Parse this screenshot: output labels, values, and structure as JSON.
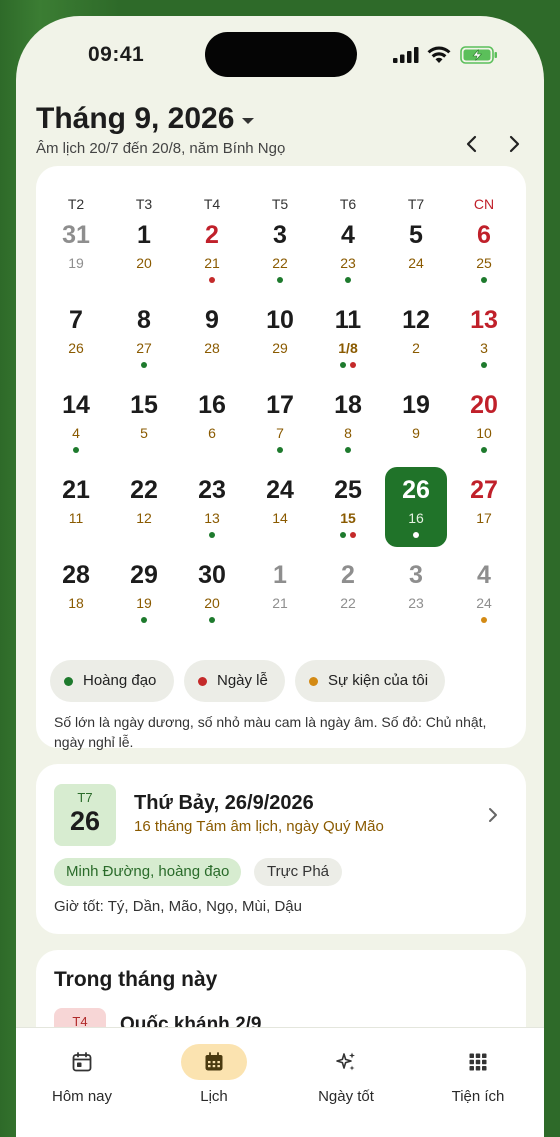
{
  "status_bar": {
    "time": "09:41"
  },
  "header": {
    "month_title": "Tháng 9, 2026",
    "subtitle": "Âm lịch 20/7 đến 20/8, năm Bính Ngọ"
  },
  "calendar": {
    "weekdays": [
      "T2",
      "T3",
      "T4",
      "T5",
      "T6",
      "T7",
      "CN"
    ],
    "weeks": [
      [
        {
          "day": "31",
          "lunar": "19",
          "other": true,
          "dots": []
        },
        {
          "day": "1",
          "lunar": "20",
          "dots": []
        },
        {
          "day": "2",
          "lunar": "21",
          "holiday": true,
          "dots": [
            "red"
          ]
        },
        {
          "day": "3",
          "lunar": "22",
          "dots": [
            "green"
          ]
        },
        {
          "day": "4",
          "lunar": "23",
          "dots": [
            "green"
          ]
        },
        {
          "day": "5",
          "lunar": "24",
          "dots": []
        },
        {
          "day": "6",
          "lunar": "25",
          "dots": [
            "green"
          ]
        }
      ],
      [
        {
          "day": "7",
          "lunar": "26",
          "dots": []
        },
        {
          "day": "8",
          "lunar": "27",
          "dots": [
            "green"
          ]
        },
        {
          "day": "9",
          "lunar": "28",
          "dots": []
        },
        {
          "day": "10",
          "lunar": "29",
          "dots": []
        },
        {
          "day": "11",
          "lunar": "1/8",
          "lunar_bold": true,
          "dots": [
            "green",
            "red"
          ]
        },
        {
          "day": "12",
          "lunar": "2",
          "dots": []
        },
        {
          "day": "13",
          "lunar": "3",
          "dots": [
            "green"
          ]
        }
      ],
      [
        {
          "day": "14",
          "lunar": "4",
          "dots": [
            "green"
          ]
        },
        {
          "day": "15",
          "lunar": "5",
          "dots": []
        },
        {
          "day": "16",
          "lunar": "6",
          "dots": []
        },
        {
          "day": "17",
          "lunar": "7",
          "dots": [
            "green"
          ]
        },
        {
          "day": "18",
          "lunar": "8",
          "dots": [
            "green"
          ]
        },
        {
          "day": "19",
          "lunar": "9",
          "dots": []
        },
        {
          "day": "20",
          "lunar": "10",
          "dots": [
            "green"
          ]
        }
      ],
      [
        {
          "day": "21",
          "lunar": "11",
          "dots": []
        },
        {
          "day": "22",
          "lunar": "12",
          "dots": []
        },
        {
          "day": "23",
          "lunar": "13",
          "dots": [
            "green"
          ]
        },
        {
          "day": "24",
          "lunar": "14",
          "dots": []
        },
        {
          "day": "25",
          "lunar": "15",
          "lunar_bold": true,
          "dots": [
            "green",
            "red"
          ]
        },
        {
          "day": "26",
          "lunar": "16",
          "selected": true,
          "dots": [
            "white"
          ]
        },
        {
          "day": "27",
          "lunar": "17",
          "dots": []
        }
      ],
      [
        {
          "day": "28",
          "lunar": "18",
          "dots": []
        },
        {
          "day": "29",
          "lunar": "19",
          "dots": [
            "green"
          ]
        },
        {
          "day": "30",
          "lunar": "20",
          "dots": [
            "green"
          ]
        },
        {
          "day": "1",
          "lunar": "21",
          "other": true,
          "dots": []
        },
        {
          "day": "2",
          "lunar": "22",
          "other": true,
          "dots": []
        },
        {
          "day": "3",
          "lunar": "23",
          "other": true,
          "dots": []
        },
        {
          "day": "4",
          "lunar": "24",
          "other": true,
          "dots": [
            "orange"
          ]
        }
      ]
    ],
    "legend": [
      {
        "label": "Hoàng đạo",
        "color": "#1e7a2d"
      },
      {
        "label": "Ngày lễ",
        "color": "#c42a2a"
      },
      {
        "label": "Sự kiện của tôi",
        "color": "#d38a14"
      }
    ],
    "legend_note": "Số lớn là ngày dương, số nhỏ màu cam là ngày âm. Số đỏ: Chủ nhật, ngày nghỉ lễ."
  },
  "selected_day": {
    "weekday_short": "T7",
    "day": "26",
    "title": "Thứ Bảy, 26/9/2026",
    "lunar_desc": "16 tháng Tám âm lịch, ngày Quý Mão",
    "tag_good": "Minh Đường, hoàng đạo",
    "tag_neutral": "Trực Phá",
    "good_hours": "Giờ tốt: Tý, Dần, Mão, Ngọ, Mùi, Dậu"
  },
  "month_events": {
    "title": "Trong tháng này",
    "first_event": {
      "weekday_short": "T4",
      "title": "Quốc khánh 2/9"
    }
  },
  "bottom_nav": [
    {
      "label": "Hôm nay",
      "icon": "calendar-today-icon",
      "active": false
    },
    {
      "label": "Lịch",
      "icon": "calendar-grid-icon",
      "active": true
    },
    {
      "label": "Ngày tốt",
      "icon": "sparkles-icon",
      "active": false
    },
    {
      "label": "Tiện ích",
      "icon": "apps-grid-icon",
      "active": false
    }
  ],
  "colors": {
    "accent_green": "#207329",
    "lunar_orange": "#8a5a00",
    "sunday_red": "#c0202a",
    "active_nav_bg": "#fbe3b0"
  }
}
